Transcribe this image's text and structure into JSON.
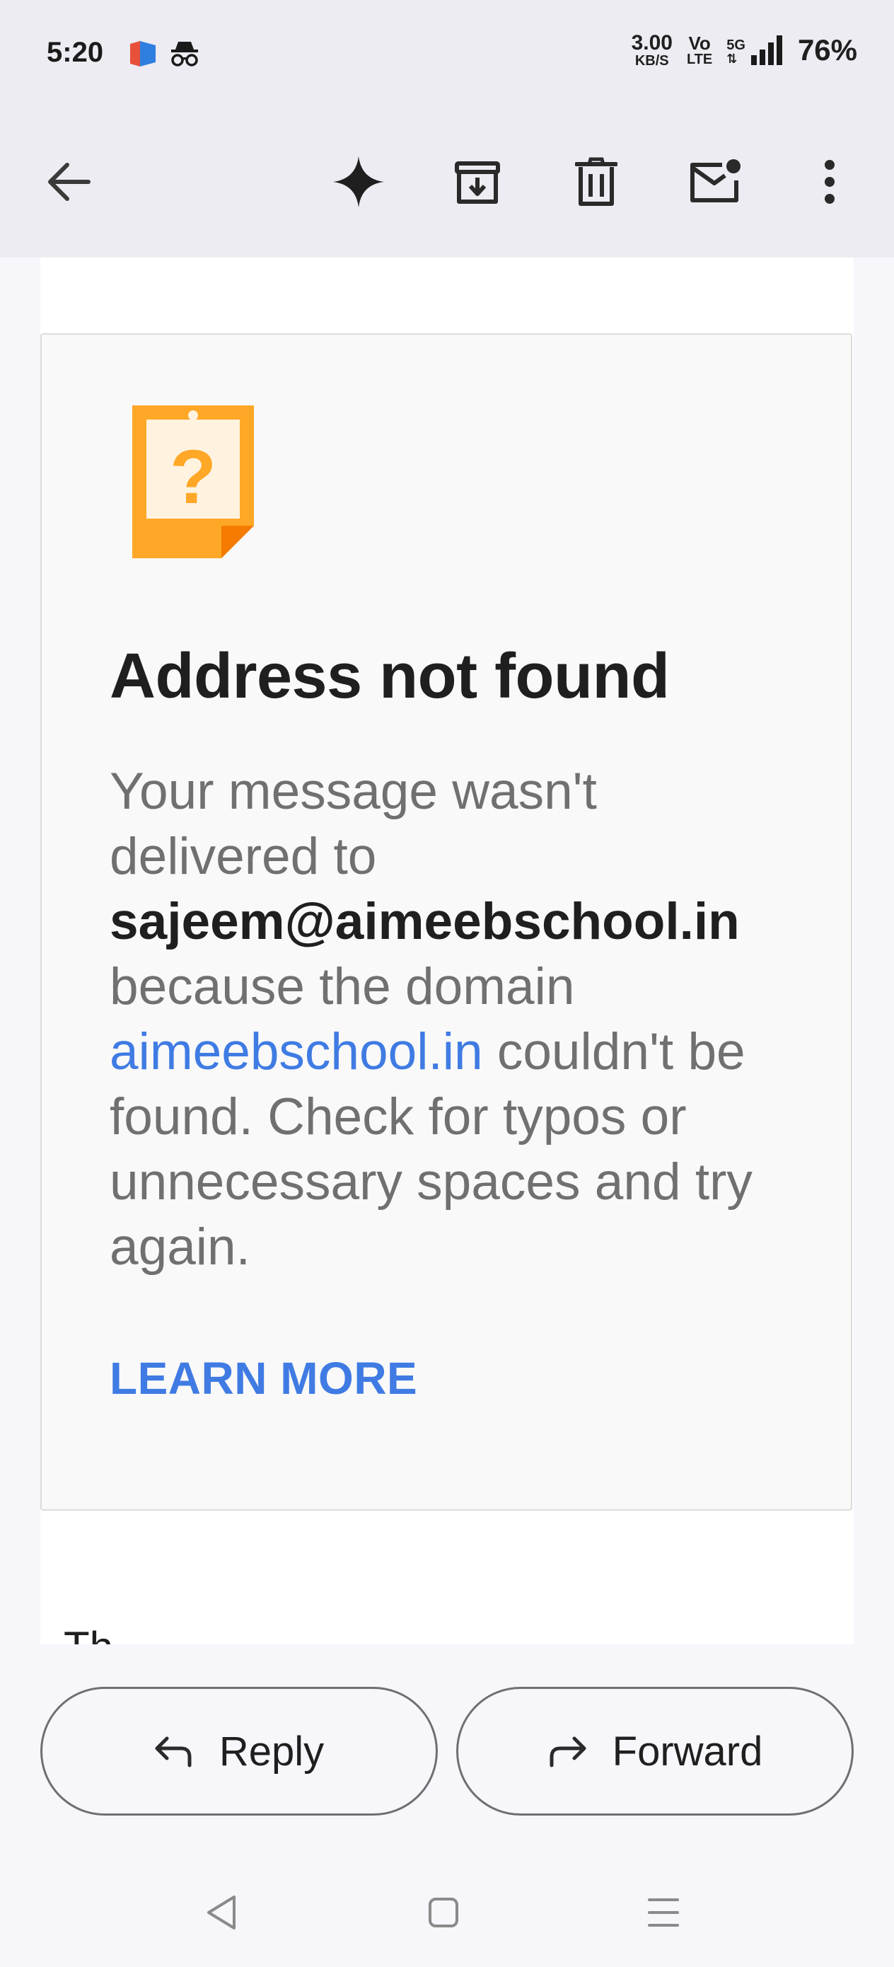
{
  "status_bar": {
    "time": "5:20",
    "net_speed_value": "3.00",
    "net_speed_unit": "KB/S",
    "volte_top": "Vo",
    "volte_bottom": "LTE",
    "network": "5G",
    "battery": "76%"
  },
  "toolbar": {
    "icons": [
      "back-arrow-icon",
      "gemini-sparkle-icon",
      "archive-icon",
      "delete-icon",
      "mark-unread-icon",
      "more-options-icon"
    ]
  },
  "bounce_card": {
    "icon": "missing-note-icon",
    "title": "Address not found",
    "body_1": "Your message wasn't delivered to ",
    "address": "sajeem@aimeebschool.in",
    "body_2": " because the domain ",
    "domain_link": "aimeebschool.in",
    "body_3": " couldn't be found. Check for typos or unnecessary spaces and try again.",
    "learn_more": "LEARN MORE"
  },
  "clipped_text": "Th",
  "actions": {
    "reply_label": "Reply",
    "forward_label": "Forward"
  },
  "colors": {
    "accent_link": "#3f7be3",
    "note_orange": "#ffa726",
    "surface": "#ececf2"
  }
}
